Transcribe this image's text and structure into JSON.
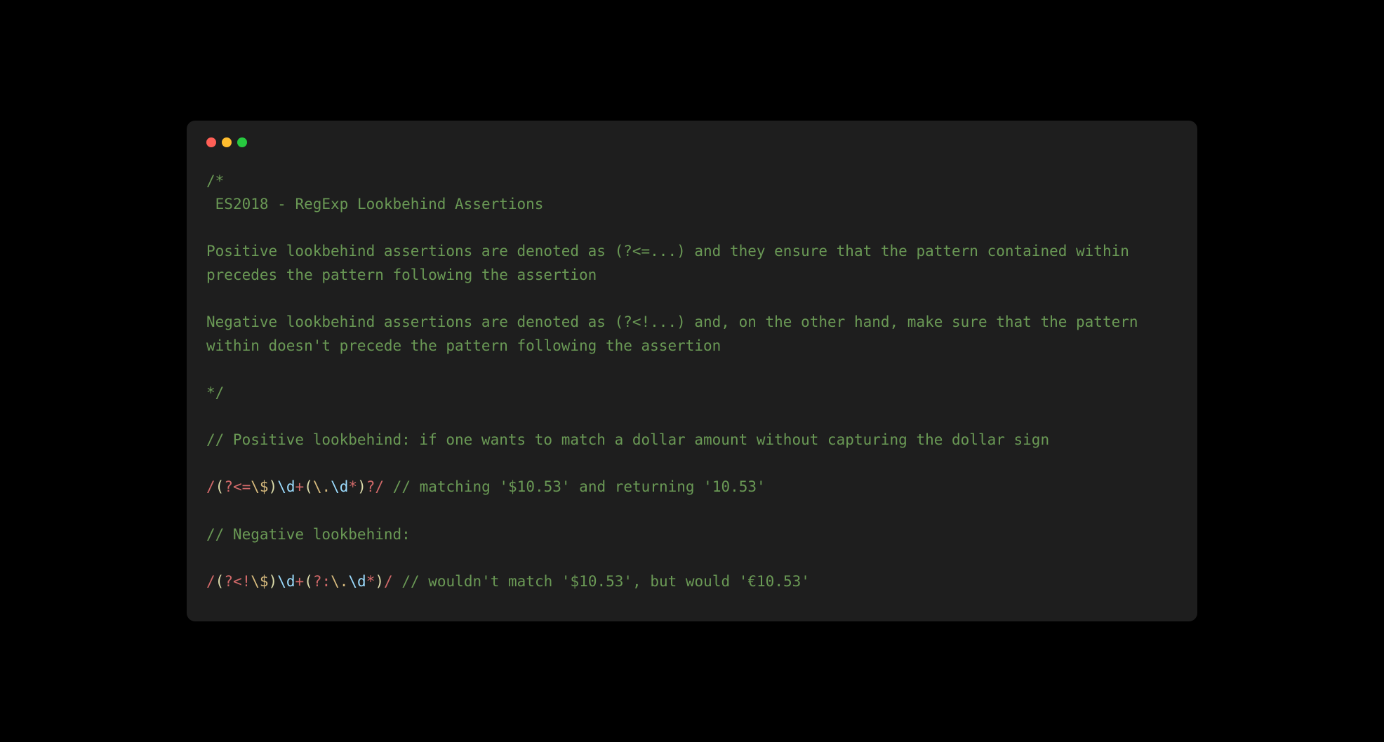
{
  "titlebar": {
    "buttons": [
      "close",
      "minimize",
      "maximize"
    ]
  },
  "code": {
    "lines": [
      {
        "type": "comment",
        "text": "/*"
      },
      {
        "type": "comment",
        "text": " ES2018 - RegExp Lookbehind Assertions"
      },
      {
        "type": "blank",
        "text": ""
      },
      {
        "type": "comment",
        "text": "Positive lookbehind assertions are denoted as (?<=...) and they ensure that the pattern contained within precedes the pattern following the assertion"
      },
      {
        "type": "blank",
        "text": ""
      },
      {
        "type": "comment",
        "text": "Negative lookbehind assertions are denoted as (?<!...) and, on the other hand, make sure that the pattern within doesn't precede the pattern following the assertion"
      },
      {
        "type": "blank",
        "text": ""
      },
      {
        "type": "comment",
        "text": "*/"
      },
      {
        "type": "blank",
        "text": ""
      },
      {
        "type": "comment",
        "text": "// Positive lookbehind: if one wants to match a dollar amount without capturing the dollar sign"
      },
      {
        "type": "blank",
        "text": ""
      },
      {
        "type": "regex1",
        "regex": "/(?<=\\$)\\d+(\\.\\d*)?/",
        "comment": " // matching '$10.53' and returning '10.53'"
      },
      {
        "type": "blank",
        "text": ""
      },
      {
        "type": "comment",
        "text": "// Negative lookbehind:"
      },
      {
        "type": "blank",
        "text": ""
      },
      {
        "type": "regex2",
        "regex": "/(?<!\\$)\\d+(?:\\.\\d*)/",
        "comment": " // wouldn't match '$10.53', but would '€10.53'"
      }
    ]
  },
  "regex1_parts": {
    "open": "/",
    "group1_open": "(",
    "lookbehind": "?<=",
    "escape_dollar": "\\$",
    "group1_close": ")",
    "digit1": "\\d",
    "plus": "+",
    "group2_open": "(",
    "escape_dot": "\\.",
    "digit2": "\\d",
    "star": "*",
    "group2_close": ")",
    "question": "?",
    "close": "/"
  },
  "regex2_parts": {
    "open": "/",
    "group1_open": "(",
    "lookbehind": "?<!",
    "escape_dollar": "\\$",
    "group1_close": ")",
    "digit1": "\\d",
    "plus": "+",
    "group2_open": "(",
    "noncapture": "?:",
    "escape_dot": "\\.",
    "digit2": "\\d",
    "star": "*",
    "group2_close": ")",
    "close": "/"
  },
  "colors": {
    "background": "#000000",
    "window": "#1e1e1e",
    "comment": "#6a9955",
    "regex": "#d16969",
    "escape": "#d7ba7d",
    "class": "#9cdcfe",
    "bracket": "#dcdcaa",
    "red": "#ff5f56",
    "yellow": "#ffbd2e",
    "green": "#27c93f"
  }
}
